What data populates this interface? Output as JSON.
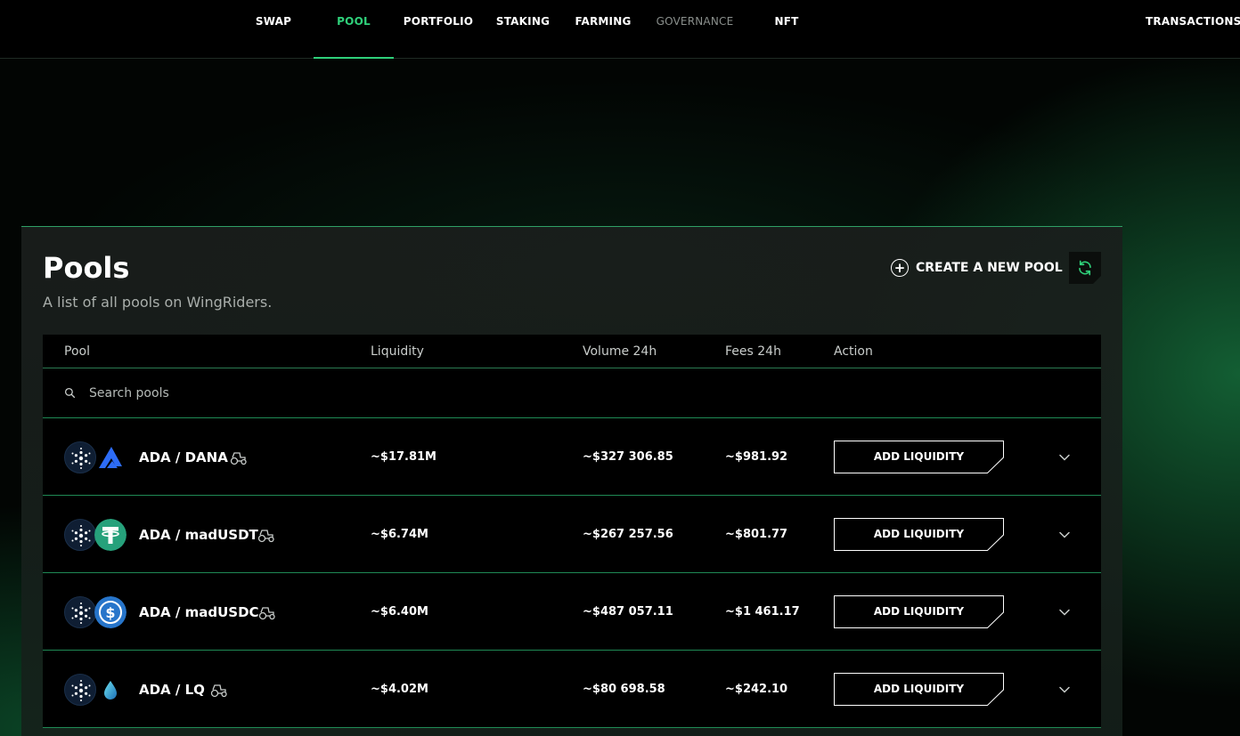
{
  "nav": {
    "items": [
      {
        "label": "SWAP",
        "active": false
      },
      {
        "label": "POOL",
        "active": true
      },
      {
        "label": "PORTFOLIO",
        "active": false
      },
      {
        "label": "STAKING",
        "active": false
      },
      {
        "label": "FARMING",
        "active": false
      },
      {
        "label": "GOVERNANCE",
        "active": false,
        "muted": true
      },
      {
        "label": "NFT",
        "active": false
      }
    ],
    "transactions_label": "TRANSACTIONS"
  },
  "header": {
    "title": "Pools",
    "subtitle": "A list of all pools on WingRiders.",
    "create_label": "CREATE A NEW POOL"
  },
  "table": {
    "columns": [
      "Pool",
      "Liquidity",
      "Volume 24h",
      "Fees 24h",
      "Action"
    ],
    "search_placeholder": "Search pools",
    "add_label": "ADD LIQUIDITY",
    "rows": [
      {
        "pair": "ADA / DANA",
        "liquidity": "~$17.81M",
        "volume": "~$327 306.85",
        "fees": "~$981.92",
        "token2": "dana-icon"
      },
      {
        "pair": "ADA / madUSDT",
        "liquidity": "~$6.74M",
        "volume": "~$267 257.56",
        "fees": "~$801.77",
        "token2": "usdt-icon"
      },
      {
        "pair": "ADA / madUSDC",
        "liquidity": "~$6.40M",
        "volume": "~$487 057.11",
        "fees": "~$1 461.17",
        "token2": "usdc-icon"
      },
      {
        "pair": "ADA / LQ",
        "liquidity": "~$4.02M",
        "volume": "~$80 698.58",
        "fees": "~$242.10",
        "token2": "lq-icon"
      }
    ]
  },
  "colors": {
    "accent": "#2fd07a",
    "row_divider": "#1f8a55",
    "background": "#000000"
  }
}
